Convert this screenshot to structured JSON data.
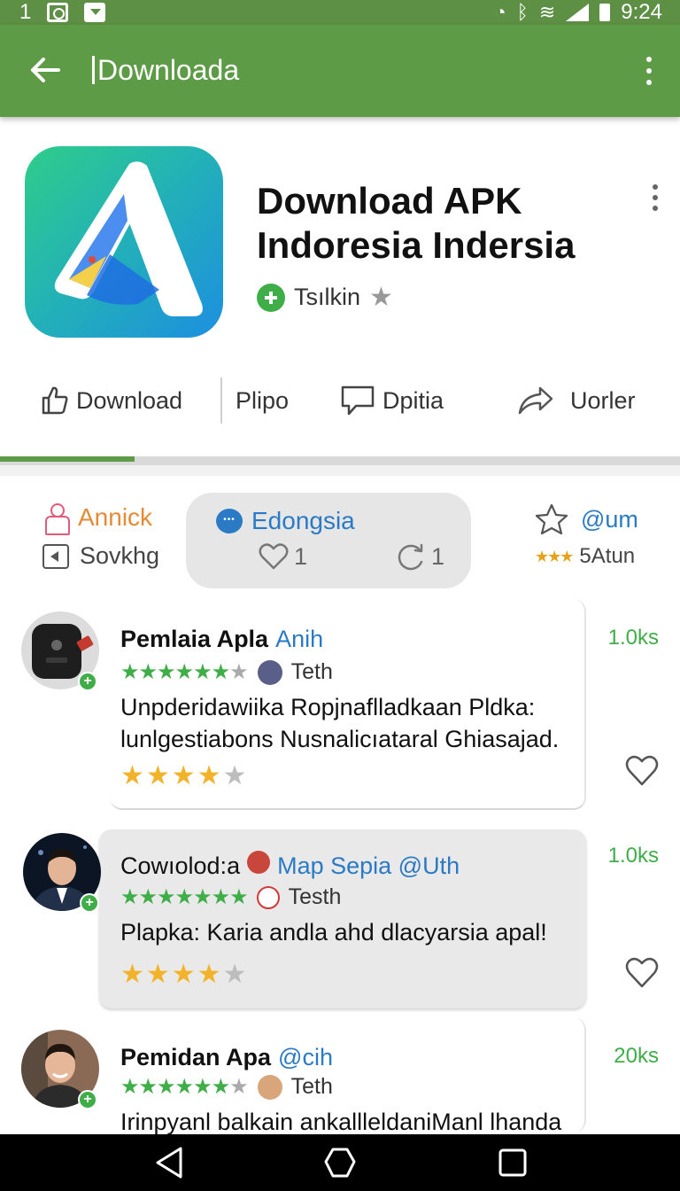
{
  "status_bar": {
    "left_text": "1",
    "icons": [
      "photo-icon",
      "sync-icon",
      "download-notification-icon"
    ],
    "right_icons": [
      "alarm-icon",
      "bluetooth-icon",
      "wifi-icon",
      "signal-icon",
      "battery-icon"
    ],
    "time": "9:24"
  },
  "appbar": {
    "title": "Downloada",
    "color": "#5e9b47"
  },
  "app": {
    "name_line1": "Download APK",
    "name_line2": "Indoresia Indersia",
    "meta_label": "Tsılkin"
  },
  "actions": [
    {
      "label": "Download",
      "icon": "thumb-up-icon"
    },
    {
      "label": "Plipo",
      "icon": ""
    },
    {
      "label": "Dpitia",
      "icon": "comment-icon"
    },
    {
      "label": "Uorler",
      "icon": "share-icon"
    }
  ],
  "filters": {
    "left": {
      "label": "Annick",
      "sub_label": "Sovkhg"
    },
    "chip": {
      "label": "Edongsia",
      "likes": "1",
      "replies": "1"
    },
    "right": {
      "label": "@um",
      "sub_label": "5Atun"
    }
  },
  "reviews": [
    {
      "name": "Pemlaia Apla",
      "handle": "Anih",
      "tag": "Teth",
      "text_line1": "Unpderidawiika Ropjnaflladkaan Pldka:",
      "text_line2": "lunlgestiabons Nusnalicıataral Ghiasajad.",
      "rating": 3.5,
      "count": "1.0ks"
    },
    {
      "name": "Cowıolod:a",
      "handle": "Map Sepia @Uth",
      "tag": "Testh",
      "text_line1": "Plapka: Karia andla ahd dlacyarsia apal!",
      "text_line2": "",
      "rating": 4,
      "count": "1.0ks"
    },
    {
      "name": "Pemidan Apa",
      "handle": "@cih",
      "tag": "Teth",
      "text_line1": "Irinpyanl balkain ankallleldaniManl lhanda",
      "text_line2": "",
      "rating": 0,
      "count": "20ks"
    }
  ],
  "navbar": {
    "buttons": [
      "back-nav-icon",
      "home-nav-icon",
      "recents-nav-icon"
    ]
  }
}
